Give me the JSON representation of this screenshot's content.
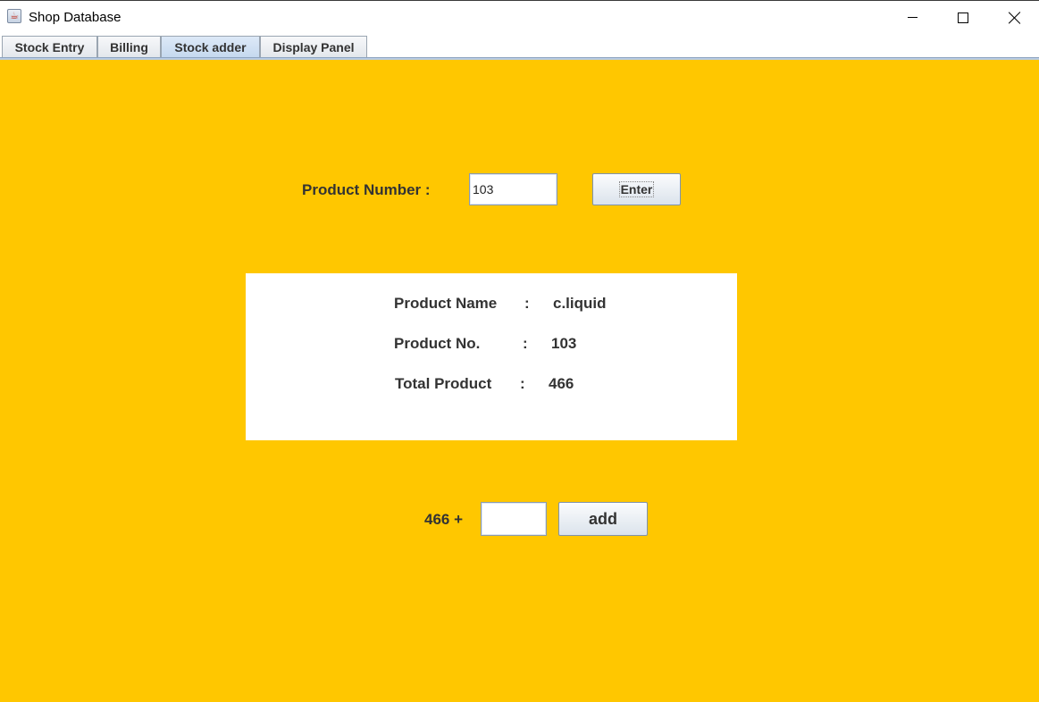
{
  "window": {
    "title": "Shop Database",
    "icon": "java-cup-icon"
  },
  "tabs": [
    {
      "label": "Stock Entry",
      "active": false
    },
    {
      "label": "Billing",
      "active": false
    },
    {
      "label": "Stock adder",
      "active": true
    },
    {
      "label": "Display Panel",
      "active": false
    }
  ],
  "colors": {
    "panel_background": "#ffc700",
    "info_box_background": "#ffffff",
    "active_tab": "#c6d9ef"
  },
  "form": {
    "product_number_label": "Product Number :",
    "product_number_value": "103",
    "enter_button": "Enter"
  },
  "info": {
    "name_label": "Product Name",
    "name_colon": ":",
    "name_value": "c.liquid",
    "number_label": "Product No.",
    "number_colon": ":",
    "number_value": "103",
    "total_label": "Total Product",
    "total_colon": ":",
    "total_value": "466"
  },
  "add": {
    "prefix": "466 +",
    "value": "",
    "button": "add"
  }
}
